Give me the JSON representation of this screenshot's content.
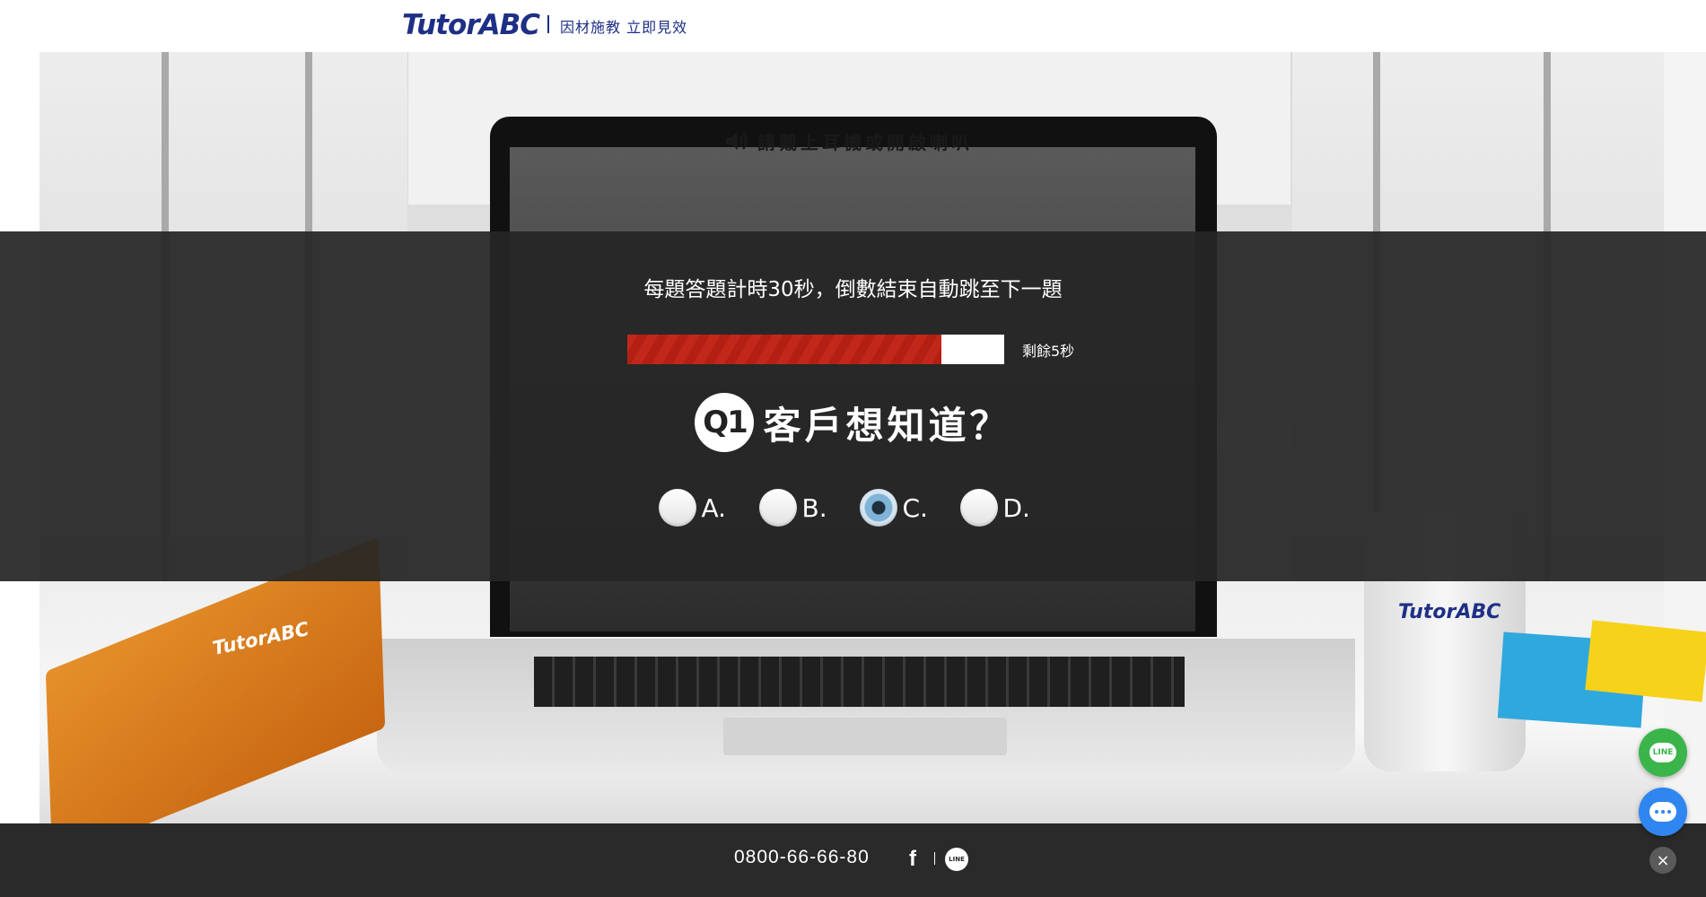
{
  "header": {
    "logo": "TutorABC",
    "tagline": "因材施教 立即見效"
  },
  "sound_notice": {
    "text": "請戴上耳機或開啟喇叭",
    "icon": "speaker-icon"
  },
  "quiz": {
    "instruction": "每題答題計時30秒，倒數結束自動跳至下一題",
    "progress_fraction": 0.833,
    "timer_text": "剩餘5秒",
    "question_badge": "Q1",
    "question_text": "客戶想知道？",
    "options": [
      {
        "label": "A.",
        "selected": false
      },
      {
        "label": "B.",
        "selected": false
      },
      {
        "label": "C.",
        "selected": true
      },
      {
        "label": "D.",
        "selected": false
      }
    ]
  },
  "scene": {
    "notebook_logo": "TutorABC",
    "cup_logo": "TutorABC"
  },
  "footer": {
    "phone": "0800-66-66-80",
    "facebook_icon": "f",
    "line_icon": "LINE"
  },
  "floating": {
    "line_label": "LINE",
    "close_icon": "×"
  },
  "colors": {
    "brand": "#1e2f86",
    "progress_fill": "#c2281a",
    "line_green": "#3bb54a",
    "chat_blue": "#2f86f0"
  }
}
